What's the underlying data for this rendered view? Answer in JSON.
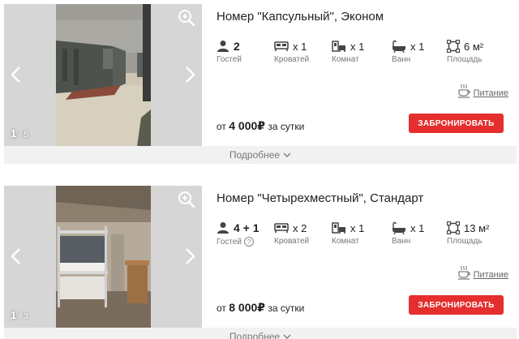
{
  "colors": {
    "accent_button": "#e52e2e",
    "gallery_bg": "#d6d6d6",
    "more_bar_bg": "#f1f1f1"
  },
  "rooms": [
    {
      "title": "Номер \"Капсульный\", Эконом",
      "photo_counter": {
        "current": "1",
        "total": "/ 5"
      },
      "amenities": {
        "guests": {
          "value": "2",
          "caption": "Гостей",
          "icon": "person-icon"
        },
        "beds": {
          "value": "x 1",
          "caption": "Кроватей",
          "icon": "bed-icon"
        },
        "rooms": {
          "value": "x 1",
          "caption": "Комнат",
          "icon": "room-icon"
        },
        "baths": {
          "value": "x 1",
          "caption": "Ванн",
          "icon": "bathtub-icon"
        },
        "area": {
          "value": "6 м²",
          "caption": "Площадь",
          "icon": "area-icon"
        }
      },
      "meal_label": "Питание",
      "price": {
        "prefix": "от",
        "amount": "4 000₽",
        "suffix": "за сутки"
      },
      "book_label": "ЗАБРОНИРОВАТЬ",
      "more_label": "Подробнее"
    },
    {
      "title": "Номер \"Четырехместный\", Стандарт",
      "photo_counter": {
        "current": "1",
        "total": "/ 3"
      },
      "amenities": {
        "guests": {
          "value": "4 + 1",
          "caption": "Гостей",
          "icon": "person-icon",
          "help": "?"
        },
        "beds": {
          "value": "x 2",
          "caption": "Кроватей",
          "icon": "bed-icon"
        },
        "rooms": {
          "value": "x 1",
          "caption": "Комнат",
          "icon": "room-icon"
        },
        "baths": {
          "value": "x 1",
          "caption": "Ванн",
          "icon": "bathtub-icon"
        },
        "area": {
          "value": "13 м²",
          "caption": "Площадь",
          "icon": "area-icon"
        }
      },
      "meal_label": "Питание",
      "price": {
        "prefix": "от",
        "amount": "8 000₽",
        "suffix": "за сутки"
      },
      "book_label": "ЗАБРОНИРОВАТЬ",
      "more_label": "Подробнее"
    }
  ]
}
